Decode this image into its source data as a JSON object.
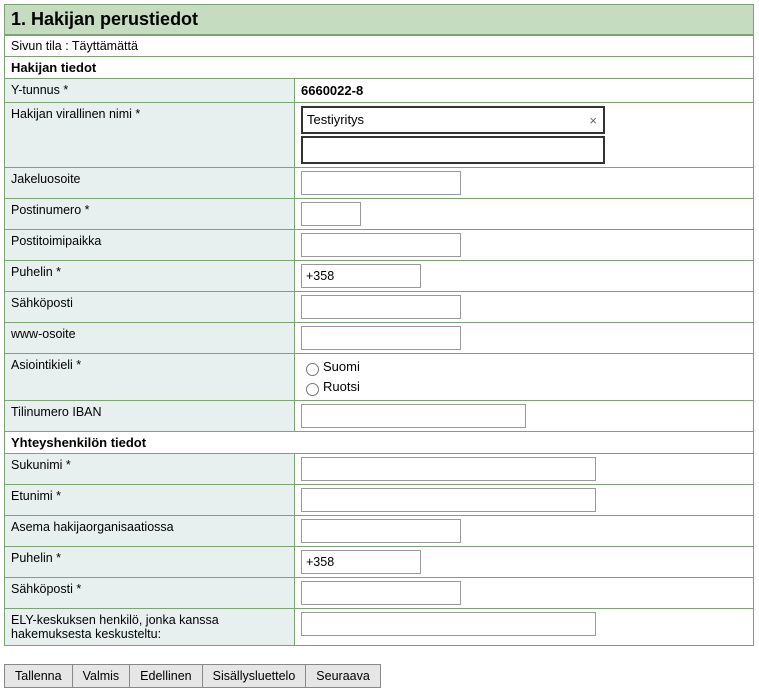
{
  "title": "1. Hakijan perustiedot",
  "status_label": "Sivun tila : ",
  "status_value": "Täyttämättä",
  "section1": "Hakijan tiedot",
  "ytunnus_label": "Y-tunnus *",
  "ytunnus_value": "6660022-8",
  "virallinen_nimi_label": "Hakijan virallinen nimi *",
  "virallinen_nimi_value": "Testiyritys",
  "jakeluosoite_label": "Jakeluosoite",
  "postinumero_label": "Postinumero *",
  "postitoimipaikka_label": "Postitoimipaikka",
  "puhelin_label": "Puhelin *",
  "puhelin_value": "+358",
  "sahkoposti_label": "Sähköposti",
  "www_label": "www-osoite",
  "asiointikieli_label": "Asiointikieli *",
  "lang_suomi": "Suomi",
  "lang_ruotsi": "Ruotsi",
  "tilinumero_label": "Tilinumero IBAN",
  "section2": "Yhteyshenkilön tiedot",
  "sukunimi_label": "Sukunimi *",
  "etunimi_label": "Etunimi *",
  "asema_label": "Asema hakijaorganisaatiossa",
  "c_puhelin_label": "Puhelin *",
  "c_puhelin_value": "+358",
  "c_sahkoposti_label": "Sähköposti *",
  "ely_label": "ELY-keskuksen henkilö, jonka kanssa hakemuksesta keskusteltu:",
  "btn_tallenna": "Tallenna",
  "btn_valmis": "Valmis",
  "btn_edellinen": "Edellinen",
  "btn_sisallys": "Sisällysluettelo",
  "btn_seuraava": "Seuraava",
  "clear_x": "×"
}
